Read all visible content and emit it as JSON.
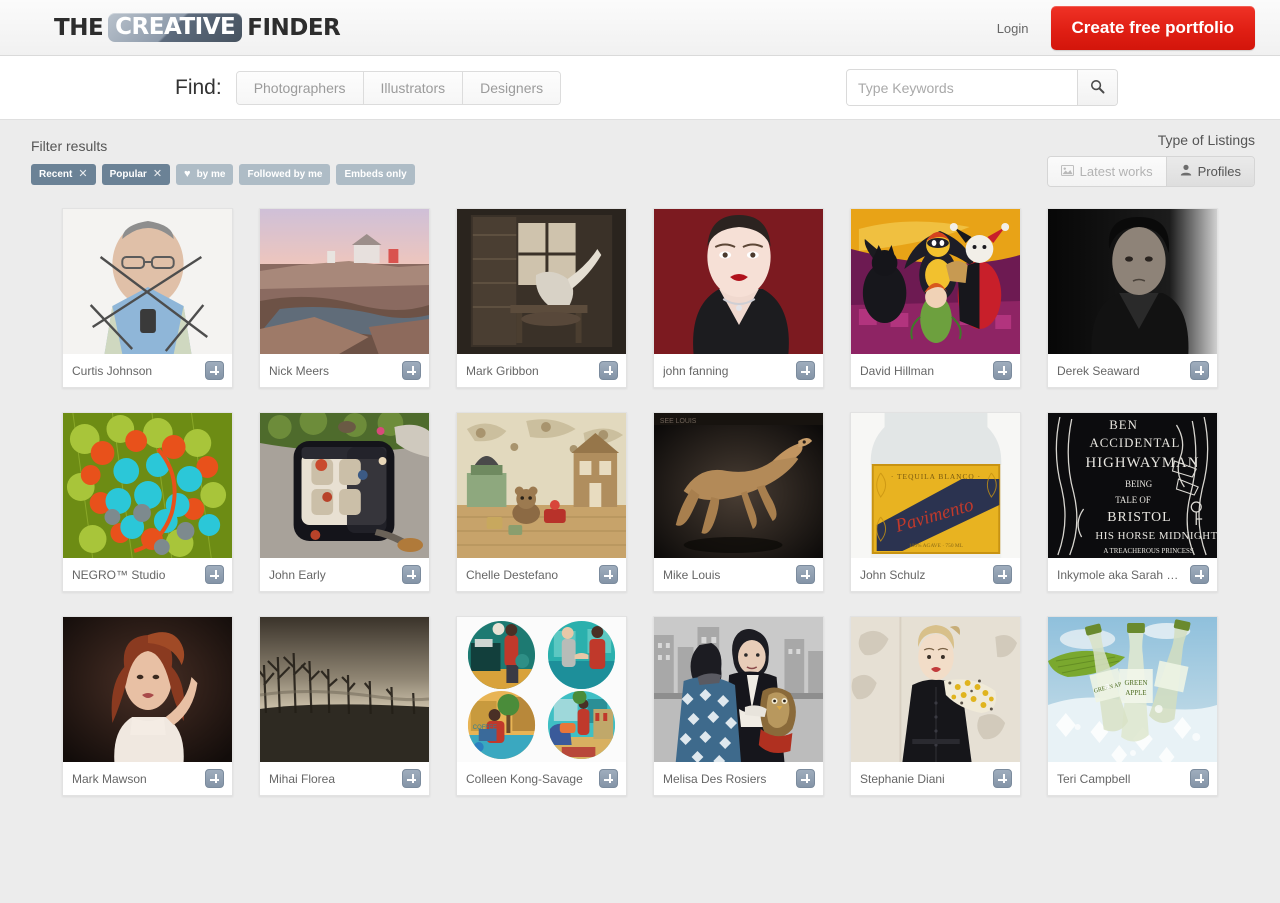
{
  "header": {
    "logo_the": "THE",
    "logo_badge": "CREATIVE",
    "logo_finder": "FINDER",
    "login_label": "Login",
    "cta_label": "Create free portfolio",
    "cta_color": "#e01f14"
  },
  "search": {
    "find_label": "Find:",
    "segments": [
      "Photographers",
      "Illustrators",
      "Designers"
    ],
    "placeholder": "Type Keywords",
    "value": "",
    "search_icon": "search-icon"
  },
  "filters": {
    "title": "Filter results",
    "pills": [
      {
        "label": "Recent",
        "close": "✕",
        "state": "active"
      },
      {
        "label": "Popular",
        "close": "✕",
        "state": "active"
      },
      {
        "label": "by me",
        "icon": "♥",
        "state": "dim"
      },
      {
        "label": "Followed by me",
        "state": "dim"
      },
      {
        "label": "Embeds only",
        "state": "dim"
      }
    ]
  },
  "listing_type": {
    "title": "Type of Listings",
    "options": [
      {
        "label": "Latest works",
        "icon": "image-icon",
        "selected": false
      },
      {
        "label": "Profiles",
        "icon": "person-icon",
        "selected": true
      }
    ]
  },
  "grid": {
    "cards": [
      {
        "name": "Curtis Johnson",
        "art": "portrait-man-glasses"
      },
      {
        "name": "Nick Meers",
        "art": "coastal-sunset"
      },
      {
        "name": "Mark Gribbon",
        "art": "sepia-interior"
      },
      {
        "name": "john fanning",
        "art": "red-lips-portrait"
      },
      {
        "name": "David Hillman",
        "art": "comic-heroes"
      },
      {
        "name": "Derek Seaward",
        "art": "bw-portrait"
      },
      {
        "name": "NEGRO™ Studio",
        "art": "molecule-render"
      },
      {
        "name": "John Early",
        "art": "overhead-car"
      },
      {
        "name": "Chelle Destefano",
        "art": "vintage-nursery"
      },
      {
        "name": "Mike Louis",
        "art": "leaping-dog"
      },
      {
        "name": "John Schulz",
        "art": "tequila-bottle"
      },
      {
        "name": "Inkymole aka Sarah J ...",
        "art": "chalk-lettering"
      },
      {
        "name": "Mark Mawson",
        "art": "red-hair-woman"
      },
      {
        "name": "Mihai Florea",
        "art": "misty-trees"
      },
      {
        "name": "Colleen Kong-Savage",
        "art": "four-circles-illustration"
      },
      {
        "name": "Melisa Des Rosiers",
        "art": "owl-street-illustration"
      },
      {
        "name": "Stephanie Diani",
        "art": "fashion-scarf"
      },
      {
        "name": "Teri Campbell",
        "art": "green-apple-bottles"
      }
    ],
    "add_button_label": "+"
  }
}
